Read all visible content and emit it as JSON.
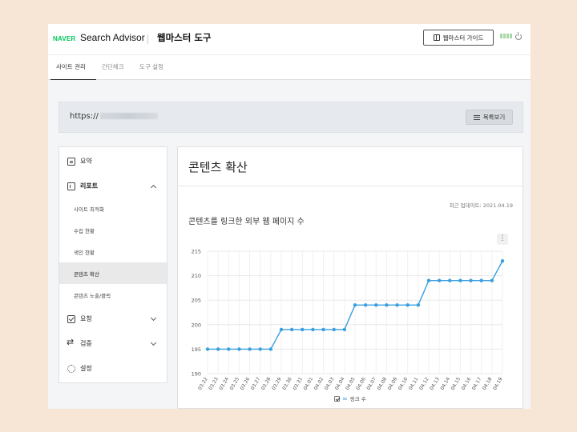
{
  "header": {
    "logo": "NAVER",
    "app_name": "Search Advisor",
    "tool_title": "웹마스터 도구",
    "guide_button": "웹마스터 가이드"
  },
  "tabs": [
    {
      "label": "사이트 관리",
      "active": true
    },
    {
      "label": "간단체크",
      "active": false
    },
    {
      "label": "도구 설정",
      "active": false
    }
  ],
  "site": {
    "url_prefix": "https://",
    "list_button": "목록보기"
  },
  "sidebar": {
    "items": [
      {
        "label": "요약",
        "icon": "clipboard-icon"
      },
      {
        "label": "리포트",
        "icon": "chart-icon",
        "expanded": true
      },
      {
        "label": "요청",
        "icon": "check-icon"
      },
      {
        "label": "검증",
        "icon": "swap-icon"
      },
      {
        "label": "설정",
        "icon": "gear-icon"
      }
    ],
    "report_subitems": [
      {
        "label": "사이트 최적화"
      },
      {
        "label": "수집 현황"
      },
      {
        "label": "색인 현황"
      },
      {
        "label": "콘텐츠 확산",
        "active": true
      },
      {
        "label": "콘텐츠 노출/클릭"
      }
    ]
  },
  "main": {
    "title": "콘텐츠 확산",
    "updated": "최근 업데이트: 2021.04.19",
    "chart_title": "콘텐츠를 링크한 외부 웹 페이지 수",
    "more": "⋮"
  },
  "chart_data": {
    "type": "line",
    "x": [
      "03.22",
      "03.23",
      "03.24",
      "03.25",
      "03.26",
      "03.27",
      "03.28",
      "03.29",
      "03.30",
      "03.31",
      "04.01",
      "04.02",
      "04.03",
      "04.04",
      "04.05",
      "04.06",
      "04.07",
      "04.08",
      "04.09",
      "04.10",
      "04.11",
      "04.12",
      "04.13",
      "04.14",
      "04.15",
      "04.16",
      "04.17",
      "04.18",
      "04.19"
    ],
    "series": [
      {
        "name": "링크 수",
        "values": [
          195,
          195,
          195,
          195,
          195,
          195,
          195,
          199,
          199,
          199,
          199,
          199,
          199,
          199,
          204,
          204,
          204,
          204,
          204,
          204,
          204,
          209,
          209,
          209,
          209,
          209,
          209,
          209,
          213
        ],
        "color": "#3a9fe0"
      }
    ],
    "ylim": [
      190,
      215
    ],
    "yticks": [
      190,
      195,
      200,
      205,
      210,
      215
    ],
    "grid": true,
    "legend": "bottom-center"
  }
}
